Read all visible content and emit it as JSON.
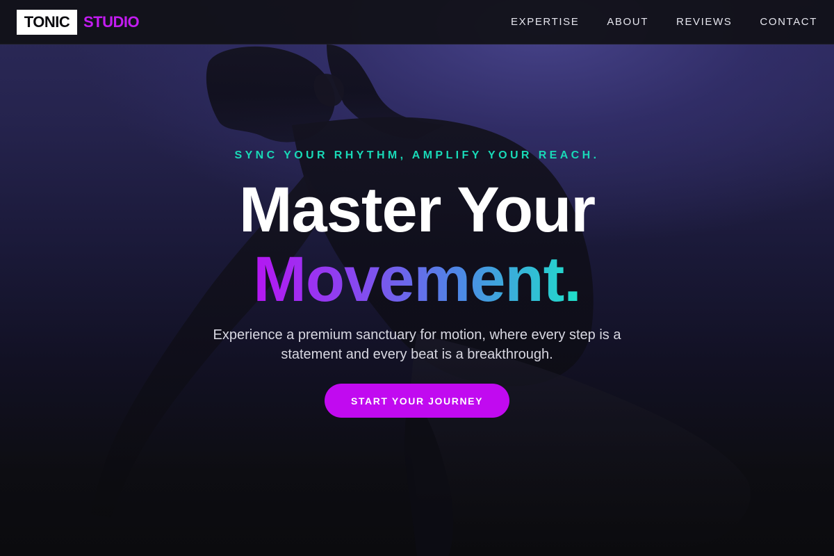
{
  "nav": {
    "logo_primary": "TONIC",
    "logo_secondary": "STUDIO",
    "links": [
      {
        "label": "EXPERTISE"
      },
      {
        "label": "ABOUT"
      },
      {
        "label": "REVIEWS"
      },
      {
        "label": "CONTACT"
      }
    ]
  },
  "hero": {
    "tagline": "SYNC YOUR RHYTHM, AMPLIFY YOUR REACH.",
    "headline_line1": "Master Your",
    "headline_line2": "Movement.",
    "subtext": "Experience a premium sanctuary for motion, where every step is a statement and every beat is a breakthrough.",
    "cta_label": "START YOUR JOURNEY"
  },
  "colors": {
    "accent_magenta": "#c10af0",
    "accent_teal": "#19d9b7",
    "nav_bg": "#101016",
    "hero_bg_top": "#2c2a5a",
    "hero_bg_bottom": "#0b0b0e"
  }
}
